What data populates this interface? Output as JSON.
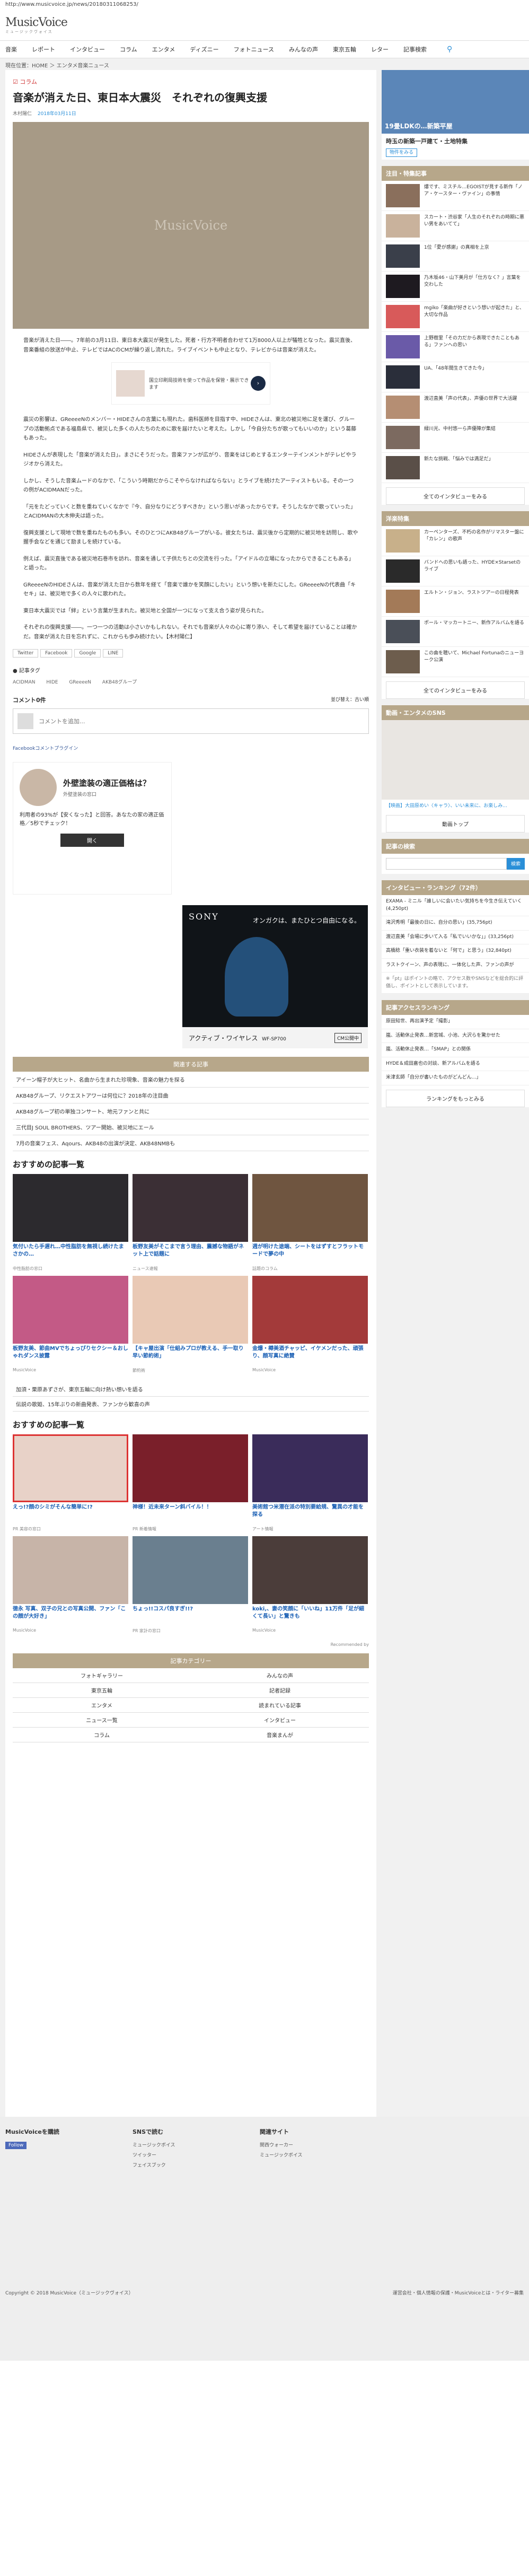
{
  "url": "http://www.musicvoice.jp/news/20180311068253/",
  "logo": {
    "name": "MusicVoice",
    "tagline": "ミュージックヴォイス"
  },
  "nav": [
    "音楽",
    "レポート",
    "インタビュー",
    "コラム",
    "エンタメ",
    "ディズニー",
    "フォトニュース",
    "みんなの声",
    "東京五輪",
    "レター",
    "記事検索"
  ],
  "breadcrumb": "現在位置：HOME ＞ エンタメ音楽ニュース",
  "article": {
    "category": "コラム",
    "title": "音楽が消えた日、東日本大震災　それぞれの復興支援",
    "author": "木村陽仁",
    "date": "2018年03月11日",
    "hero_mark": "MusicVoice",
    "paragraphs": [
      "音楽が消えた日――。7年前の3月11日、東日本大震災が発生した。死者・行方不明者合わせて1万8000人以上が犠牲となった。震災直後、音楽番組の放送が中止、テレビではACのCMが繰り返し流れた。ライブイベントも中止となり、テレビからは音楽が消えた。",
      "震災の影響は、GReeeeNのメンバー・HIDEさんの言葉にも現れた。歯科医師を目指す中、HIDEさんは、東北の被災地に足を運び、グループの活動拠点である福島県で、被災した多くの人たちのために歌を届けたいと考えた。しかし「今自分たちが歌ってもいいのか」という葛藤もあった。",
      "HIDEさんが表現した「音楽が消えた日」。まさにそうだった。音楽ファンが広がり、音楽をはじめとするエンターテインメントがテレビやラジオから消えた。",
      "しかし、そうした音楽ムードのなかで、「こういう時期だからこそやらなければならない」とライブを続けたアーティストもいる。その一つの例がACIDMANだった。",
      "「元をたどっていくと数を重ねていくなかで『今、自分なりにどうすべきか』という思いがあったからです。そうしたなかで歌っていった」とACIDMANの大木伸夫は語った。",
      "復興支援として現地で数を重ねたものも多い。そのひとつにAKB48グループがいる。彼女たちは、震災後から定期的に被災地を訪問し、歌や握手会などを通じて励ましを続けている。",
      "例えば、震災直後である被災地石巻市を訪れ、音楽を通して子供たちとの交流を行った。「アイドルの立場になったからできることもある」と語った。",
      "GReeeeNのHIDEさんは、音楽が消えた日から数年を経て「音楽で誰かを笑顔にしたい」という想いを新たにした。GReeeeNの代表曲「キセキ」は、被災地で多くの人々に歌われた。",
      "東日本大震災では「絆」という言葉が生まれた。被災地と全国が一つになって支え合う姿が見られた。",
      "それぞれの復興支援――。一つ一つの活動は小さいかもしれない。それでも音楽が人々の心に寄り添い、そして希望を届けていることは確かだ。音楽が消えた日を忘れずに、これからも歩み続けたい。【木村陽仁】"
    ],
    "ad_mid_text": "国立印刷局技術を使って作品を保管・展示できます",
    "share": [
      "Twitter",
      "Facebook",
      "Google",
      "LINE"
    ],
    "tag_head": "記事タグ",
    "tags": [
      "ACIDMAN",
      "HIDE",
      "GReeeeN",
      "AKB48グループ"
    ],
    "comments_label": "コメント0件",
    "comments_sort": "並び替え：古い順",
    "comment_placeholder": "コメントを追加...",
    "fb_plugin": "Facebookコメントプラグイン"
  },
  "ad_box": {
    "headline": "外壁塗装の適正価格は？",
    "sub": "外壁塗装の窓口",
    "desc": "利用者の93%が【安くなった】と回答。あなたの家の適正価格／5秒でチェック！",
    "button": "開く"
  },
  "sony": {
    "brand": "SONY",
    "copy": "オンガクは、またひとつ自由になる。",
    "product": "アクティブ・ワイヤレス",
    "model": "WF-SP700",
    "cm": "CM公開中"
  },
  "related": {
    "head": "関連する記事",
    "items": [
      "アイーン帽子が大ヒット、名曲から生まれた珍現象、音楽の魅力を探る",
      "AKB48グループ、リクエストアワーは何位に？2018年の注目曲",
      "AKB48グループ初の単独コンサート、地元ファンと共に",
      "三代目J SOUL BROTHERS、ツアー開始、被災地にエール",
      "7月の音楽フェス、Aqours、AKB48の出演が決定、AKB48NMBも"
    ]
  },
  "recommend1": {
    "title": "おすすめの記事一覧",
    "cards": [
      {
        "cap": "気付いたら手遅れ…中性脂肪を無視し続けたまさかの…",
        "src": "中性脂肪の窓口"
      },
      {
        "cap": "板野友美がそこまで言う理由、震撼な物語がネット上で話題に",
        "src": "ニュース速報"
      },
      {
        "cap": "週が明けた途端、シートをはずすとフラットモードで夢の中",
        "src": "話題のコラム"
      },
      {
        "cap": "板野友美、節曲MVでちょっぴりセクシー＆おしゃれダンス披露",
        "src": "MusicVoice"
      },
      {
        "cap": "【キャ屋出演「仕組みプロが教える、手一取り早い節約術」",
        "src": "節約術"
      },
      {
        "cap": "金爆・樽美酒チャッピ、イケメンだった、頑張り、顔写真に絶賛",
        "src": "MusicVoice"
      }
    ]
  },
  "pickup": [
    "加須・栗原あずさが、東京五輪に向け熱い想いを語る",
    "伝説の歌姫、15年ぶりの新曲発表、ファンから歓喜の声"
  ],
  "recommend2": {
    "title": "おすすめの記事一覧",
    "cards": [
      {
        "cap": "えっ!?顔のシミがそんな簡単に!?",
        "src": "PR 美容の窓口"
      },
      {
        "cap": "神様！近未来ターン斜バイル！！",
        "src": "PR 新着情報"
      },
      {
        "cap": "美術館つ米潜在派の特別要給規、驚異の才能を探る",
        "src": "アート情報"
      },
      {
        "cap": "徳永 写真、双子の兄との写真公開、ファン「この顔が大好き」",
        "src": "MusicVoice"
      },
      {
        "cap": "ちょっ!!コスパ良すぎ!!?",
        "src": "PR 家計の窓口"
      },
      {
        "cap": "koki,、妻の笑顔に「いいね」11万件「足が細くて長い」と驚きも",
        "src": "MusicVoice"
      }
    ]
  },
  "powered": "Recommended by",
  "categories": {
    "head": "記事カテゴリー",
    "items": [
      "フォトギャラリー",
      "みんなの声",
      "東京五輪",
      "記者記録",
      "エンタメ",
      "読まれている記事",
      "ニュース一覧",
      "インタビュー",
      "コラム",
      "音楽まんが"
    ]
  },
  "side": {
    "top_ad": {
      "title": "19畳LDKの…新築平屋",
      "sub": "時玉の新築一戸建て・土地特集",
      "btn": "物件をみる"
    },
    "notice": {
      "head": "注目・特集記事",
      "items": [
        "爆です、ミスチル…EGOISTが見する新作「ノア・ケースター・ヴァイン」の事情",
        "スカート・渋谷家「人生のそれぞれの時期に悪い男をあいてて」",
        "1位「愛が感謝」の真相を上京",
        "乃木坂46・山下美月が「仕方なく？」言葉を交わした",
        "mgiko「楽曲が好きという想いが起きた」と、大切な作品",
        "上野樹里「その力だから表現できたこともある」ファンへの思い",
        "UA、「48年間生きてきた今」",
        "渡辺直美「声の代表」、声優の世界で大活躍",
        "緑川光、中村悠一ら声優陣が集結",
        "新たな挑戦、「悩みでは満足だ」"
      ],
      "more": "全てのインタビューをみる"
    },
    "western": {
      "head": "洋楽特集",
      "items": [
        "カーペンターズ、不朽の名作がリマスター盤に「カレン」の歌声",
        "バンドへの思いも語った、HYDE×Starsetのライブ",
        "エルトン・ジョン、ラストツアーの日程発表",
        "ポール・マッカートニー、新作アルバムを語る",
        "この曲を聴いて、Michael Fortunaのニューヨーク公演"
      ],
      "more": "全てのインタビューをみる"
    },
    "movie": {
      "head": "動画・エンタメのSNS",
      "cap": "【映画】大田原めい〈キャラ〉、いい未来に、お楽しみ..."
    },
    "movie_more": "動画トップ",
    "kizi": {
      "head": "記事の検索",
      "btn": "検索"
    },
    "ranking": {
      "head": "インタビュー・ランキング（72件）",
      "items": [
        "EXAMA - ミニル「誰しいに会いたい気持ちを今生き伝えていく(4,250pt)",
        "滝沢秀明「最後の日に、自分の思い」(35,756pt)",
        "渡辺直美「会場に歩いて入る「私でいいかな」」(33,256pt)",
        "高橋稔「重い衣装を着ないと「何で」と思う」(32,840pt)",
        "ラストクイーン、声の表現に、一体化した声、ファンの声が"
      ],
      "note": "※「pt」はポイントの略で、アクセス数やSNSなどを総合的に評価し、ポイントとして表示しています。"
    },
    "access": {
      "head": "記事アクセスランキング",
      "items": [
        "原田知世、再出演予定「撮影」",
        "嵐、活動休止発表…新宮城、小池、大沢らを驚かせた",
        "嵐、活動休止発表…「SMAP」との関係",
        "HYDE＆成田嘉也の対談、新アルバムを語る",
        "米津玄師「自分が書いたものがどんどん...」"
      ],
      "more": "ランキングをもっとみる"
    }
  },
  "footer": {
    "col1_head": "MusicVoiceを購読",
    "fb": "Follow",
    "col2_head": "SNSで読む",
    "col2_items": [
      "ミュージックボイス",
      "ツイッター",
      "フェイスブック"
    ],
    "col3_head": "関連サイト",
    "col3_items": [
      "関西ウォーカー",
      "ミュージックボイス"
    ],
    "copyright": "Copyright © 2018 MusicVoice（ミュージックヴォイス）",
    "links": "運営会社・個人情報の保護・MusicVoiceとは・ライター募集"
  }
}
